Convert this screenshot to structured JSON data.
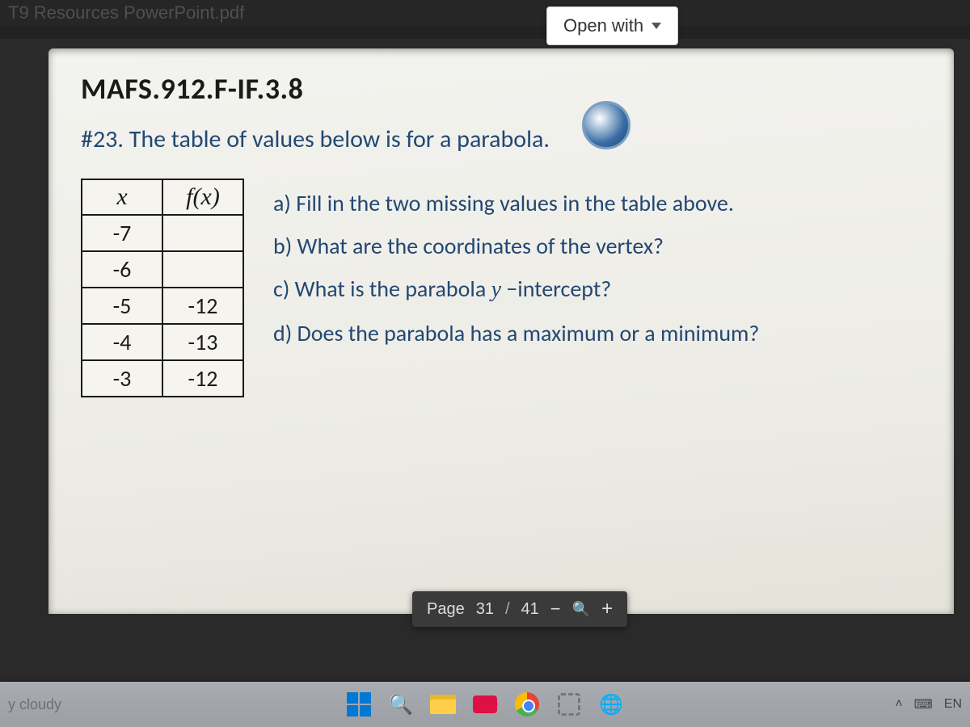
{
  "browser_tab": {
    "title": "T9 Resources PowerPoint.pdf"
  },
  "viewer": {
    "open_with_label": "Open with"
  },
  "slide": {
    "standard_code": "MAFS.912.F-IF.3.8",
    "question_stem": "#23. The table of values below is for a parabola.",
    "table": {
      "headers": {
        "x": "x",
        "fx": "f(x)"
      },
      "rows": [
        {
          "x": "-7",
          "fx": ""
        },
        {
          "x": "-6",
          "fx": ""
        },
        {
          "x": "-5",
          "fx": "-12"
        },
        {
          "x": "-4",
          "fx": "-13"
        },
        {
          "x": "-3",
          "fx": "-12"
        }
      ]
    },
    "subparts": {
      "a": "a) Fill in the two missing values in the table above.",
      "b": "b) What are the coordinates of the vertex?",
      "c_pre": "c) What is the parabola ",
      "c_var": "y",
      "c_post": " −intercept?",
      "d": "d) Does the parabola has a maximum or a minimum?"
    }
  },
  "page_toolbar": {
    "page_label": "Page",
    "current": "31",
    "sep": "/",
    "total": "41"
  },
  "taskbar": {
    "weather": "y cloudy",
    "lang": "EN"
  }
}
